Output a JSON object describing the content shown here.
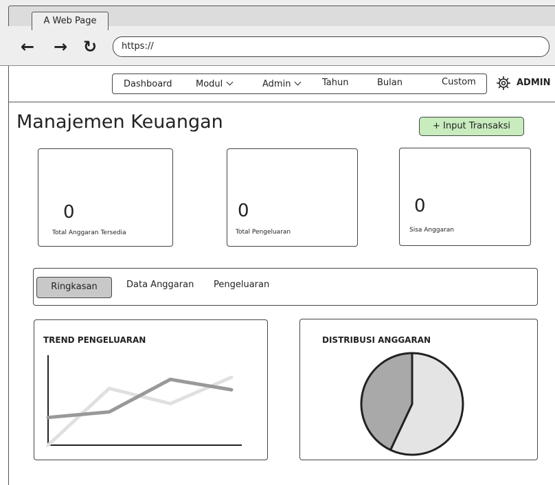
{
  "browser": {
    "tab_title": "A Web Page",
    "url": "https://"
  },
  "nav": {
    "items": [
      {
        "label": "Dashboard"
      },
      {
        "label": "Modul"
      },
      {
        "label": "Admin"
      },
      {
        "label": "Tahun"
      },
      {
        "label": "Bulan"
      },
      {
        "label": "Custom"
      }
    ],
    "user_label": "ADMIN",
    "icon": "gear-icon"
  },
  "page": {
    "title": "Manajemen Keuangan",
    "input_button": "+ Input Transaksi",
    "input_button_color": "#c8ecbe"
  },
  "cards": [
    {
      "value": "0",
      "label": "Total Anggaran Tersedia"
    },
    {
      "value": "0",
      "label": "Total Pengeluaran"
    },
    {
      "value": "0",
      "label": "Sisa Anggaran"
    }
  ],
  "tabs": [
    {
      "label": "Ringkasan",
      "active": true
    },
    {
      "label": "Data Anggaran",
      "active": false
    },
    {
      "label": "Pengeluaran",
      "active": false
    }
  ],
  "charts": {
    "trend_title": "TREND PENGELUARAN",
    "distribution_title": "DISTRIBUSI ANGGARAN"
  },
  "chart_data": [
    {
      "type": "line",
      "title": "TREND PENGELUARAN",
      "x": [
        1,
        2,
        3,
        4
      ],
      "series": [
        {
          "values": [
            4.0,
            4.8,
            9.5,
            8.0
          ],
          "color": "#999999"
        },
        {
          "values": [
            0.0,
            8.2,
            6.0,
            9.8
          ],
          "color": "#e0e0e0"
        }
      ],
      "ylim": [
        0,
        13
      ],
      "grid": false
    },
    {
      "type": "pie",
      "title": "DISTRIBUSI ANGGARAN",
      "values": [
        57,
        43
      ],
      "colors": [
        "#e4e4e4",
        "#a9a9a9"
      ]
    }
  ]
}
